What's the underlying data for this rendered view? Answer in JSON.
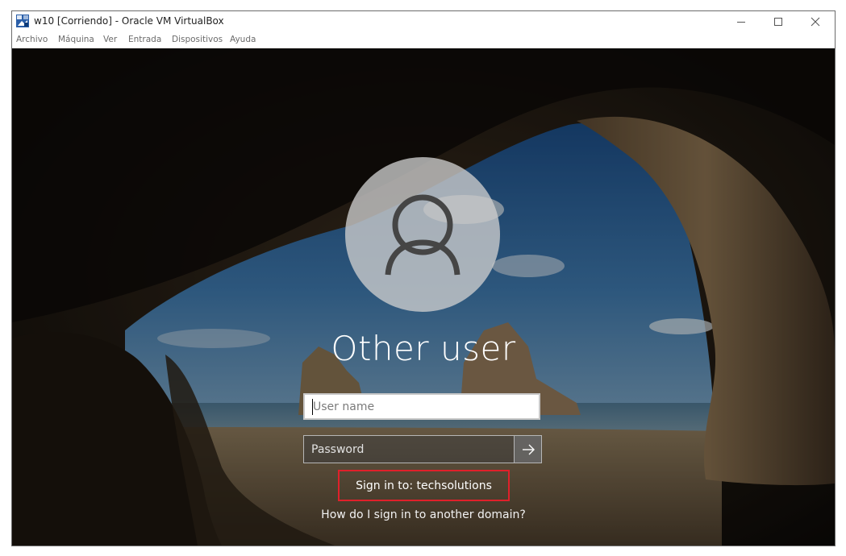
{
  "window": {
    "title": "w10 [Corriendo] - Oracle VM VirtualBox",
    "controls": [
      "minimize-icon",
      "maximize-icon",
      "close-icon"
    ]
  },
  "menubar": {
    "items": [
      "Archivo",
      "Máquina",
      "Ver",
      "Entrada",
      "Dispositivos",
      "Ayuda"
    ]
  },
  "login": {
    "avatar_icon": "user-icon",
    "title": "Other user",
    "username_placeholder": "User name",
    "password_placeholder": "Password",
    "submit_icon": "arrow-right-icon",
    "sign_in_to": "Sign in to: techsolutions",
    "other_domain_link": "How do I sign in to another domain?",
    "highlight_color": "#e0202a"
  }
}
